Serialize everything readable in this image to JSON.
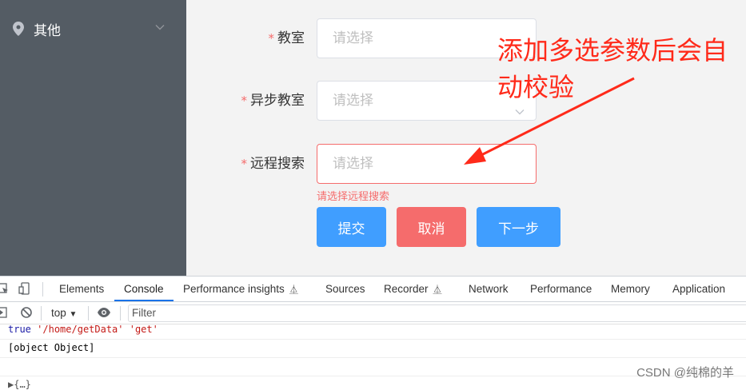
{
  "sidebar": {
    "menu_item_label": "其他"
  },
  "form": {
    "required_mark": "*",
    "rows": [
      {
        "label": "教室",
        "placeholder": "请选择"
      },
      {
        "label": "异步教室",
        "placeholder": "请选择"
      },
      {
        "label": "远程搜索",
        "placeholder": "请选择"
      }
    ],
    "error_message": "请选择远程搜索",
    "buttons": {
      "submit": "提交",
      "cancel": "取消",
      "next": "下一步"
    }
  },
  "annotation": {
    "text": "添加多选参数后会自动校验"
  },
  "devtools": {
    "tabs": [
      "Elements",
      "Console",
      "Performance insights",
      "Sources",
      "Recorder",
      "Network",
      "Performance",
      "Memory",
      "Application"
    ],
    "active_tab": "Console",
    "context": "top",
    "filter_placeholder": "Filter",
    "console": {
      "line1_kw": "true",
      "line1_str": "'/home/getData' 'get'",
      "line2": "[object Object]",
      "line3": "▶{…}"
    }
  },
  "watermark": "CSDN @纯棉的羊",
  "colors": {
    "sidebar_bg": "#545c64",
    "primary": "#409eff",
    "danger": "#f56c6c",
    "annotation_red": "#ff2a1a"
  }
}
